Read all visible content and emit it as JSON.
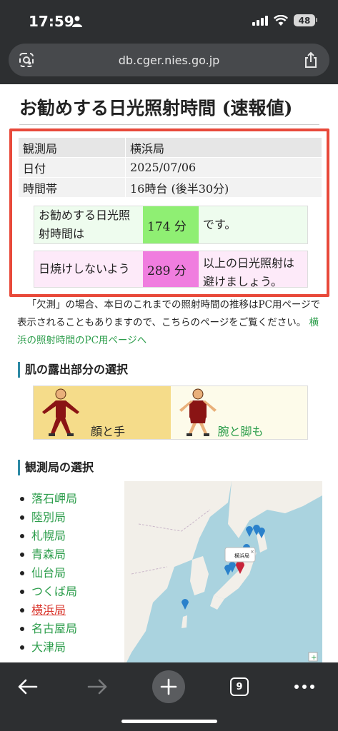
{
  "status": {
    "time": "17:59",
    "battery": "48"
  },
  "browser": {
    "url": "db.cger.nies.go.jp",
    "tab_count": "9"
  },
  "page": {
    "title": "お勧めする日光照射時間 (速報値)"
  },
  "info_table": [
    {
      "label": "観測局",
      "value": "横浜局"
    },
    {
      "label": "日付",
      "value": "2025/07/06"
    },
    {
      "label": "時間帯",
      "value": "16時台 (後半30分)"
    }
  ],
  "recommend": {
    "label": "お勧めする日光照射時間は",
    "value": "174 分",
    "suffix": "です。",
    "colors": {
      "bg": "#eefcee",
      "value_bg": "#8fef73"
    }
  },
  "avoid": {
    "label": "日焼けしないよう",
    "value": "289 分",
    "suffix": "以上の日光照射は避けましょう。",
    "colors": {
      "bg": "#fdeaf9",
      "value_bg": "#f07ddf"
    }
  },
  "note": {
    "text": "「欠測」の場合、本日のこれまでの照射時間の推移はPC用ページで表示されることもありますので、こちらのページをご覧ください。",
    "link": "横浜の照射時間のPC用ページへ"
  },
  "body_section": {
    "title": "肌の露出部分の選択",
    "options": [
      "顔と手",
      "腕と脚も"
    ]
  },
  "station_section": {
    "title": "観測局の選択",
    "stations": [
      "落石岬局",
      "陸別局",
      "札幌局",
      "青森局",
      "仙台局",
      "つくば局",
      "横浜局",
      "名古屋局",
      "大津局"
    ],
    "current": "横浜局",
    "map_popup": "横浜局"
  },
  "colors": {
    "link": "#2c9d4b",
    "current": "#d9342b",
    "highlight_border": "#e8493a",
    "chrome": "#2d2f31"
  }
}
